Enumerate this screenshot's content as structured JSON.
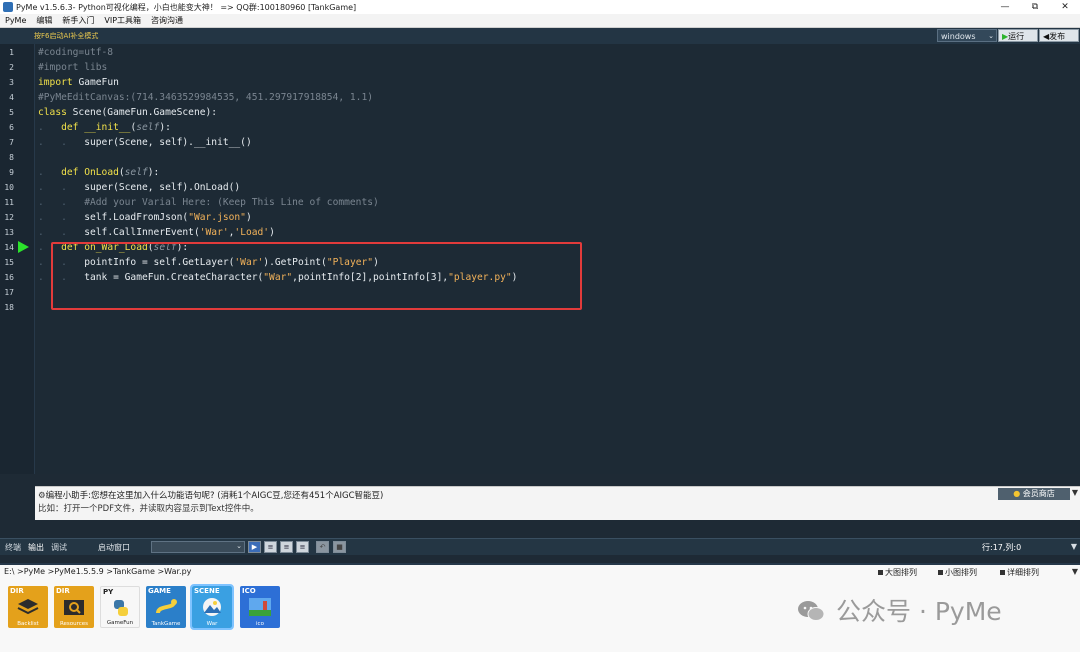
{
  "window": {
    "title": "PyMe v1.5.6.3- Python可视化编程，小白也能变大神！ => QQ群:100180960  [TankGame]",
    "controls": [
      "—",
      "⧉",
      "✕"
    ]
  },
  "menu": [
    "PyMe",
    "编辑",
    "新手入门",
    "VIP工具箱",
    "咨询沟通"
  ],
  "toolbar": {
    "ai_hint": "按F6启动AI补全模式",
    "os_select": "windows",
    "run_label": "运行",
    "publish_label": "发布"
  },
  "editor": {
    "line_numbers": [
      "1",
      "2",
      "3",
      "4",
      "5",
      "6",
      "7",
      "8",
      "9",
      "10",
      "11",
      "12",
      "13",
      "14",
      "15",
      "16",
      "17",
      "18"
    ],
    "breakpoint_line": "14",
    "lines": [
      {
        "indent": 0,
        "segments": [
          {
            "t": "#coding=utf-8",
            "c": "cm"
          }
        ]
      },
      {
        "indent": 0,
        "segments": [
          {
            "t": "#import libs",
            "c": "cm"
          }
        ]
      },
      {
        "indent": 0,
        "segments": [
          {
            "t": "import ",
            "c": "kw"
          },
          {
            "t": "GameFun",
            "c": "tx"
          }
        ]
      },
      {
        "indent": 0,
        "segments": [
          {
            "t": "#PyMeEditCanvas:(714.3463529984535, 451.297917918854, 1.1)",
            "c": "cm"
          }
        ]
      },
      {
        "indent": 0,
        "segments": [
          {
            "t": "class ",
            "c": "kw"
          },
          {
            "t": "Scene(GameFun.GameScene):",
            "c": "tx"
          }
        ]
      },
      {
        "indent": 1,
        "segments": [
          {
            "t": "def ",
            "c": "kw"
          },
          {
            "t": "__init__",
            "c": "fn"
          },
          {
            "t": "(",
            "c": "tx"
          },
          {
            "t": "self",
            "c": "self"
          },
          {
            "t": "):",
            "c": "tx"
          }
        ]
      },
      {
        "indent": 2,
        "segments": [
          {
            "t": "super(Scene, self).__init__()",
            "c": "tx"
          }
        ]
      },
      {
        "indent": 0,
        "segments": []
      },
      {
        "indent": 1,
        "segments": [
          {
            "t": "def ",
            "c": "kw"
          },
          {
            "t": "OnLoad",
            "c": "fn"
          },
          {
            "t": "(",
            "c": "tx"
          },
          {
            "t": "self",
            "c": "self"
          },
          {
            "t": "):",
            "c": "tx"
          }
        ]
      },
      {
        "indent": 2,
        "segments": [
          {
            "t": "super(Scene, self).OnLoad()",
            "c": "tx"
          }
        ]
      },
      {
        "indent": 2,
        "segments": [
          {
            "t": "#Add your Varial Here: (Keep This Line of comments)",
            "c": "cm"
          }
        ]
      },
      {
        "indent": 2,
        "segments": [
          {
            "t": "self.LoadFromJson(",
            "c": "tx"
          },
          {
            "t": "\"War.json\"",
            "c": "str"
          },
          {
            "t": ")",
            "c": "tx"
          }
        ]
      },
      {
        "indent": 2,
        "segments": [
          {
            "t": "self.CallInnerEvent(",
            "c": "tx"
          },
          {
            "t": "'War'",
            "c": "str"
          },
          {
            "t": ",",
            "c": "tx"
          },
          {
            "t": "'Load'",
            "c": "str"
          },
          {
            "t": ")",
            "c": "tx"
          }
        ]
      },
      {
        "indent": 1,
        "segments": [
          {
            "t": "def ",
            "c": "kw"
          },
          {
            "t": "on_War_Load",
            "c": "fn"
          },
          {
            "t": "(",
            "c": "tx"
          },
          {
            "t": "self",
            "c": "self"
          },
          {
            "t": "):",
            "c": "tx"
          }
        ]
      },
      {
        "indent": 2,
        "segments": [
          {
            "t": "pointInfo = self.GetLayer(",
            "c": "tx"
          },
          {
            "t": "'War'",
            "c": "str"
          },
          {
            "t": ").GetPoint(",
            "c": "tx"
          },
          {
            "t": "\"Player\"",
            "c": "str"
          },
          {
            "t": ")",
            "c": "tx"
          }
        ]
      },
      {
        "indent": 2,
        "segments": [
          {
            "t": "tank = GameFun.CreateCharacter(",
            "c": "tx"
          },
          {
            "t": "\"War\"",
            "c": "str"
          },
          {
            "t": ",pointInfo[2],pointInfo[3],",
            "c": "tx"
          },
          {
            "t": "\"player.py\"",
            "c": "str"
          },
          {
            "t": ")",
            "c": "tx"
          }
        ]
      },
      {
        "indent": 0,
        "segments": []
      },
      {
        "indent": 0,
        "segments": []
      }
    ]
  },
  "assistant": {
    "question": "编程小助手:您想在这里加入什么功能语句呢? (消耗1个AIGC豆,您还有451个AIGC智能豆)",
    "example": "比如：打开一个PDF文件，并读取内容显示到Text控件中。",
    "member_button": "会员商店"
  },
  "bottom_tabs": {
    "tabs": [
      "终端",
      "输出",
      "调试"
    ],
    "active_tab": "输出",
    "start_window_label": "启动窗口",
    "cursor_position": "行:17,列:0"
  },
  "file_pane": {
    "path": "E:\\ >PyMe >PyMe1.5.5.9 >TankGame >War.py",
    "view_options": [
      "大图排列",
      "小图排列",
      "详细排列"
    ],
    "files": [
      {
        "tag": "DIR",
        "name": "Backlist",
        "kind": "folder"
      },
      {
        "tag": "DIR",
        "name": "Resources",
        "kind": "folder"
      },
      {
        "tag": "PY",
        "name": "GameFun",
        "kind": "py"
      },
      {
        "tag": "GAME",
        "name": "TankGame",
        "kind": "game"
      },
      {
        "tag": "SCENE",
        "name": "War",
        "kind": "scene"
      },
      {
        "tag": "ICO",
        "name": "ico",
        "kind": "ico"
      }
    ]
  },
  "watermark": "公众号 · PyMe",
  "colors": {
    "editor_bg": "#1d2a35",
    "keyword": "#f0e04a",
    "string": "#f2b25a",
    "comment": "#7a8590",
    "highlight_box": "#e23b3b",
    "breakpoint": "#2be22b"
  }
}
